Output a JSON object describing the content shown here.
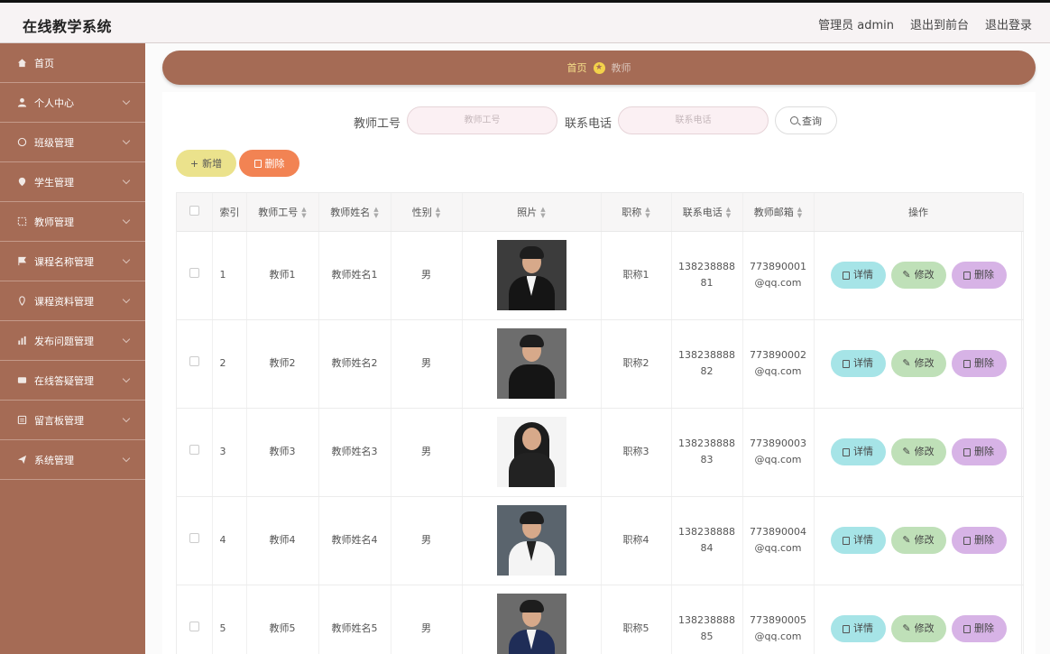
{
  "app": {
    "title": "在线教学系统"
  },
  "topbar": {
    "user_label": "管理员 admin",
    "front_label": "退出到前台",
    "logout_label": "退出登录"
  },
  "sidebar": {
    "items": [
      {
        "label": "首页",
        "icon": "home-icon"
      },
      {
        "label": "个人中心",
        "icon": "user-icon"
      },
      {
        "label": "班级管理",
        "icon": "class-icon"
      },
      {
        "label": "学生管理",
        "icon": "student-icon"
      },
      {
        "label": "教师管理",
        "icon": "teacher-icon"
      },
      {
        "label": "课程名称管理",
        "icon": "flag-icon"
      },
      {
        "label": "课程资料管理",
        "icon": "document-icon"
      },
      {
        "label": "发布问题管理",
        "icon": "chart-icon"
      },
      {
        "label": "在线答疑管理",
        "icon": "chat-icon"
      },
      {
        "label": "留言板管理",
        "icon": "message-icon"
      },
      {
        "label": "系统管理",
        "icon": "send-icon"
      }
    ]
  },
  "breadcrumb": {
    "home": "首页",
    "current": "教师"
  },
  "search": {
    "teacher_no_label": "教师工号",
    "teacher_no_placeholder": "教师工号",
    "phone_label": "联系电话",
    "phone_placeholder": "联系电话",
    "query_label": "查询"
  },
  "toolbar": {
    "add_label": "新增",
    "delete_label": "删除"
  },
  "table": {
    "headers": {
      "index": "索引",
      "teacher_no": "教师工号",
      "teacher_name": "教师姓名",
      "gender": "性别",
      "photo": "照片",
      "title": "职称",
      "phone": "联系电话",
      "email": "教师邮箱",
      "actions": "操作"
    },
    "actions": {
      "detail": "详情",
      "edit": "修改",
      "delete": "删除"
    },
    "rows": [
      {
        "index": "1",
        "teacher_no": "教师1",
        "teacher_name": "教师姓名1",
        "gender": "男",
        "title": "职称1",
        "phone_a": "138238888",
        "phone_b": "81",
        "email_a": "773890001",
        "email_b": "@qq.com"
      },
      {
        "index": "2",
        "teacher_no": "教师2",
        "teacher_name": "教师姓名2",
        "gender": "男",
        "title": "职称2",
        "phone_a": "138238888",
        "phone_b": "82",
        "email_a": "773890002",
        "email_b": "@qq.com"
      },
      {
        "index": "3",
        "teacher_no": "教师3",
        "teacher_name": "教师姓名3",
        "gender": "男",
        "title": "职称3",
        "phone_a": "138238888",
        "phone_b": "83",
        "email_a": "773890003",
        "email_b": "@qq.com"
      },
      {
        "index": "4",
        "teacher_no": "教师4",
        "teacher_name": "教师姓名4",
        "gender": "男",
        "title": "职称4",
        "phone_a": "138238888",
        "phone_b": "84",
        "email_a": "773890004",
        "email_b": "@qq.com"
      },
      {
        "index": "5",
        "teacher_no": "教师5",
        "teacher_name": "教师姓名5",
        "gender": "男",
        "title": "职称5",
        "phone_a": "138238888",
        "phone_b": "85",
        "email_a": "773890005",
        "email_b": "@qq.com"
      }
    ]
  },
  "colors": {
    "sidebar": "#a56b55",
    "add": "#ebe28c",
    "delete": "#f28353",
    "detail": "#a6e4e7",
    "edit": "#bfe0b8",
    "remove": "#d7b3e6"
  }
}
